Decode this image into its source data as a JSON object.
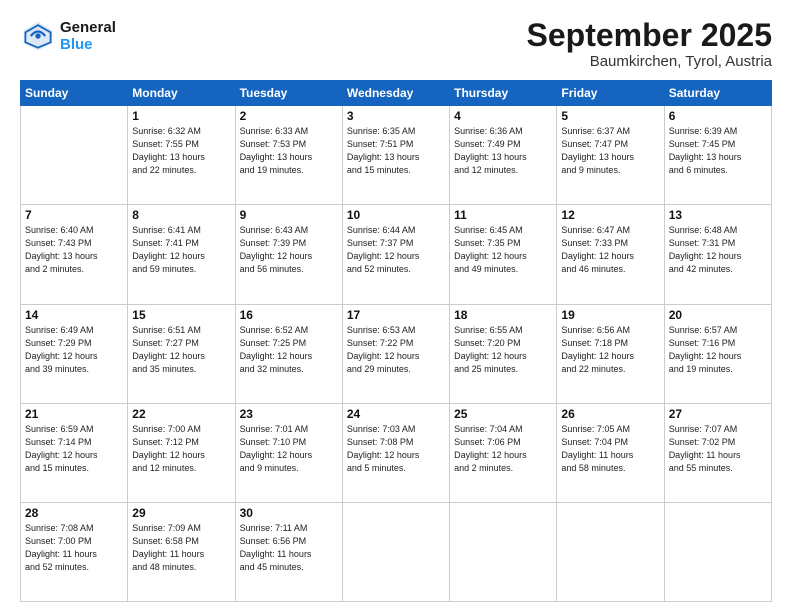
{
  "header": {
    "logo_general": "General",
    "logo_blue": "Blue",
    "month_title": "September 2025",
    "location": "Baumkirchen, Tyrol, Austria"
  },
  "days_of_week": [
    "Sunday",
    "Monday",
    "Tuesday",
    "Wednesday",
    "Thursday",
    "Friday",
    "Saturday"
  ],
  "weeks": [
    [
      {
        "day": "",
        "info": ""
      },
      {
        "day": "1",
        "info": "Sunrise: 6:32 AM\nSunset: 7:55 PM\nDaylight: 13 hours\nand 22 minutes."
      },
      {
        "day": "2",
        "info": "Sunrise: 6:33 AM\nSunset: 7:53 PM\nDaylight: 13 hours\nand 19 minutes."
      },
      {
        "day": "3",
        "info": "Sunrise: 6:35 AM\nSunset: 7:51 PM\nDaylight: 13 hours\nand 15 minutes."
      },
      {
        "day": "4",
        "info": "Sunrise: 6:36 AM\nSunset: 7:49 PM\nDaylight: 13 hours\nand 12 minutes."
      },
      {
        "day": "5",
        "info": "Sunrise: 6:37 AM\nSunset: 7:47 PM\nDaylight: 13 hours\nand 9 minutes."
      },
      {
        "day": "6",
        "info": "Sunrise: 6:39 AM\nSunset: 7:45 PM\nDaylight: 13 hours\nand 6 minutes."
      }
    ],
    [
      {
        "day": "7",
        "info": "Sunrise: 6:40 AM\nSunset: 7:43 PM\nDaylight: 13 hours\nand 2 minutes."
      },
      {
        "day": "8",
        "info": "Sunrise: 6:41 AM\nSunset: 7:41 PM\nDaylight: 12 hours\nand 59 minutes."
      },
      {
        "day": "9",
        "info": "Sunrise: 6:43 AM\nSunset: 7:39 PM\nDaylight: 12 hours\nand 56 minutes."
      },
      {
        "day": "10",
        "info": "Sunrise: 6:44 AM\nSunset: 7:37 PM\nDaylight: 12 hours\nand 52 minutes."
      },
      {
        "day": "11",
        "info": "Sunrise: 6:45 AM\nSunset: 7:35 PM\nDaylight: 12 hours\nand 49 minutes."
      },
      {
        "day": "12",
        "info": "Sunrise: 6:47 AM\nSunset: 7:33 PM\nDaylight: 12 hours\nand 46 minutes."
      },
      {
        "day": "13",
        "info": "Sunrise: 6:48 AM\nSunset: 7:31 PM\nDaylight: 12 hours\nand 42 minutes."
      }
    ],
    [
      {
        "day": "14",
        "info": "Sunrise: 6:49 AM\nSunset: 7:29 PM\nDaylight: 12 hours\nand 39 minutes."
      },
      {
        "day": "15",
        "info": "Sunrise: 6:51 AM\nSunset: 7:27 PM\nDaylight: 12 hours\nand 35 minutes."
      },
      {
        "day": "16",
        "info": "Sunrise: 6:52 AM\nSunset: 7:25 PM\nDaylight: 12 hours\nand 32 minutes."
      },
      {
        "day": "17",
        "info": "Sunrise: 6:53 AM\nSunset: 7:22 PM\nDaylight: 12 hours\nand 29 minutes."
      },
      {
        "day": "18",
        "info": "Sunrise: 6:55 AM\nSunset: 7:20 PM\nDaylight: 12 hours\nand 25 minutes."
      },
      {
        "day": "19",
        "info": "Sunrise: 6:56 AM\nSunset: 7:18 PM\nDaylight: 12 hours\nand 22 minutes."
      },
      {
        "day": "20",
        "info": "Sunrise: 6:57 AM\nSunset: 7:16 PM\nDaylight: 12 hours\nand 19 minutes."
      }
    ],
    [
      {
        "day": "21",
        "info": "Sunrise: 6:59 AM\nSunset: 7:14 PM\nDaylight: 12 hours\nand 15 minutes."
      },
      {
        "day": "22",
        "info": "Sunrise: 7:00 AM\nSunset: 7:12 PM\nDaylight: 12 hours\nand 12 minutes."
      },
      {
        "day": "23",
        "info": "Sunrise: 7:01 AM\nSunset: 7:10 PM\nDaylight: 12 hours\nand 9 minutes."
      },
      {
        "day": "24",
        "info": "Sunrise: 7:03 AM\nSunset: 7:08 PM\nDaylight: 12 hours\nand 5 minutes."
      },
      {
        "day": "25",
        "info": "Sunrise: 7:04 AM\nSunset: 7:06 PM\nDaylight: 12 hours\nand 2 minutes."
      },
      {
        "day": "26",
        "info": "Sunrise: 7:05 AM\nSunset: 7:04 PM\nDaylight: 11 hours\nand 58 minutes."
      },
      {
        "day": "27",
        "info": "Sunrise: 7:07 AM\nSunset: 7:02 PM\nDaylight: 11 hours\nand 55 minutes."
      }
    ],
    [
      {
        "day": "28",
        "info": "Sunrise: 7:08 AM\nSunset: 7:00 PM\nDaylight: 11 hours\nand 52 minutes."
      },
      {
        "day": "29",
        "info": "Sunrise: 7:09 AM\nSunset: 6:58 PM\nDaylight: 11 hours\nand 48 minutes."
      },
      {
        "day": "30",
        "info": "Sunrise: 7:11 AM\nSunset: 6:56 PM\nDaylight: 11 hours\nand 45 minutes."
      },
      {
        "day": "",
        "info": ""
      },
      {
        "day": "",
        "info": ""
      },
      {
        "day": "",
        "info": ""
      },
      {
        "day": "",
        "info": ""
      }
    ]
  ]
}
